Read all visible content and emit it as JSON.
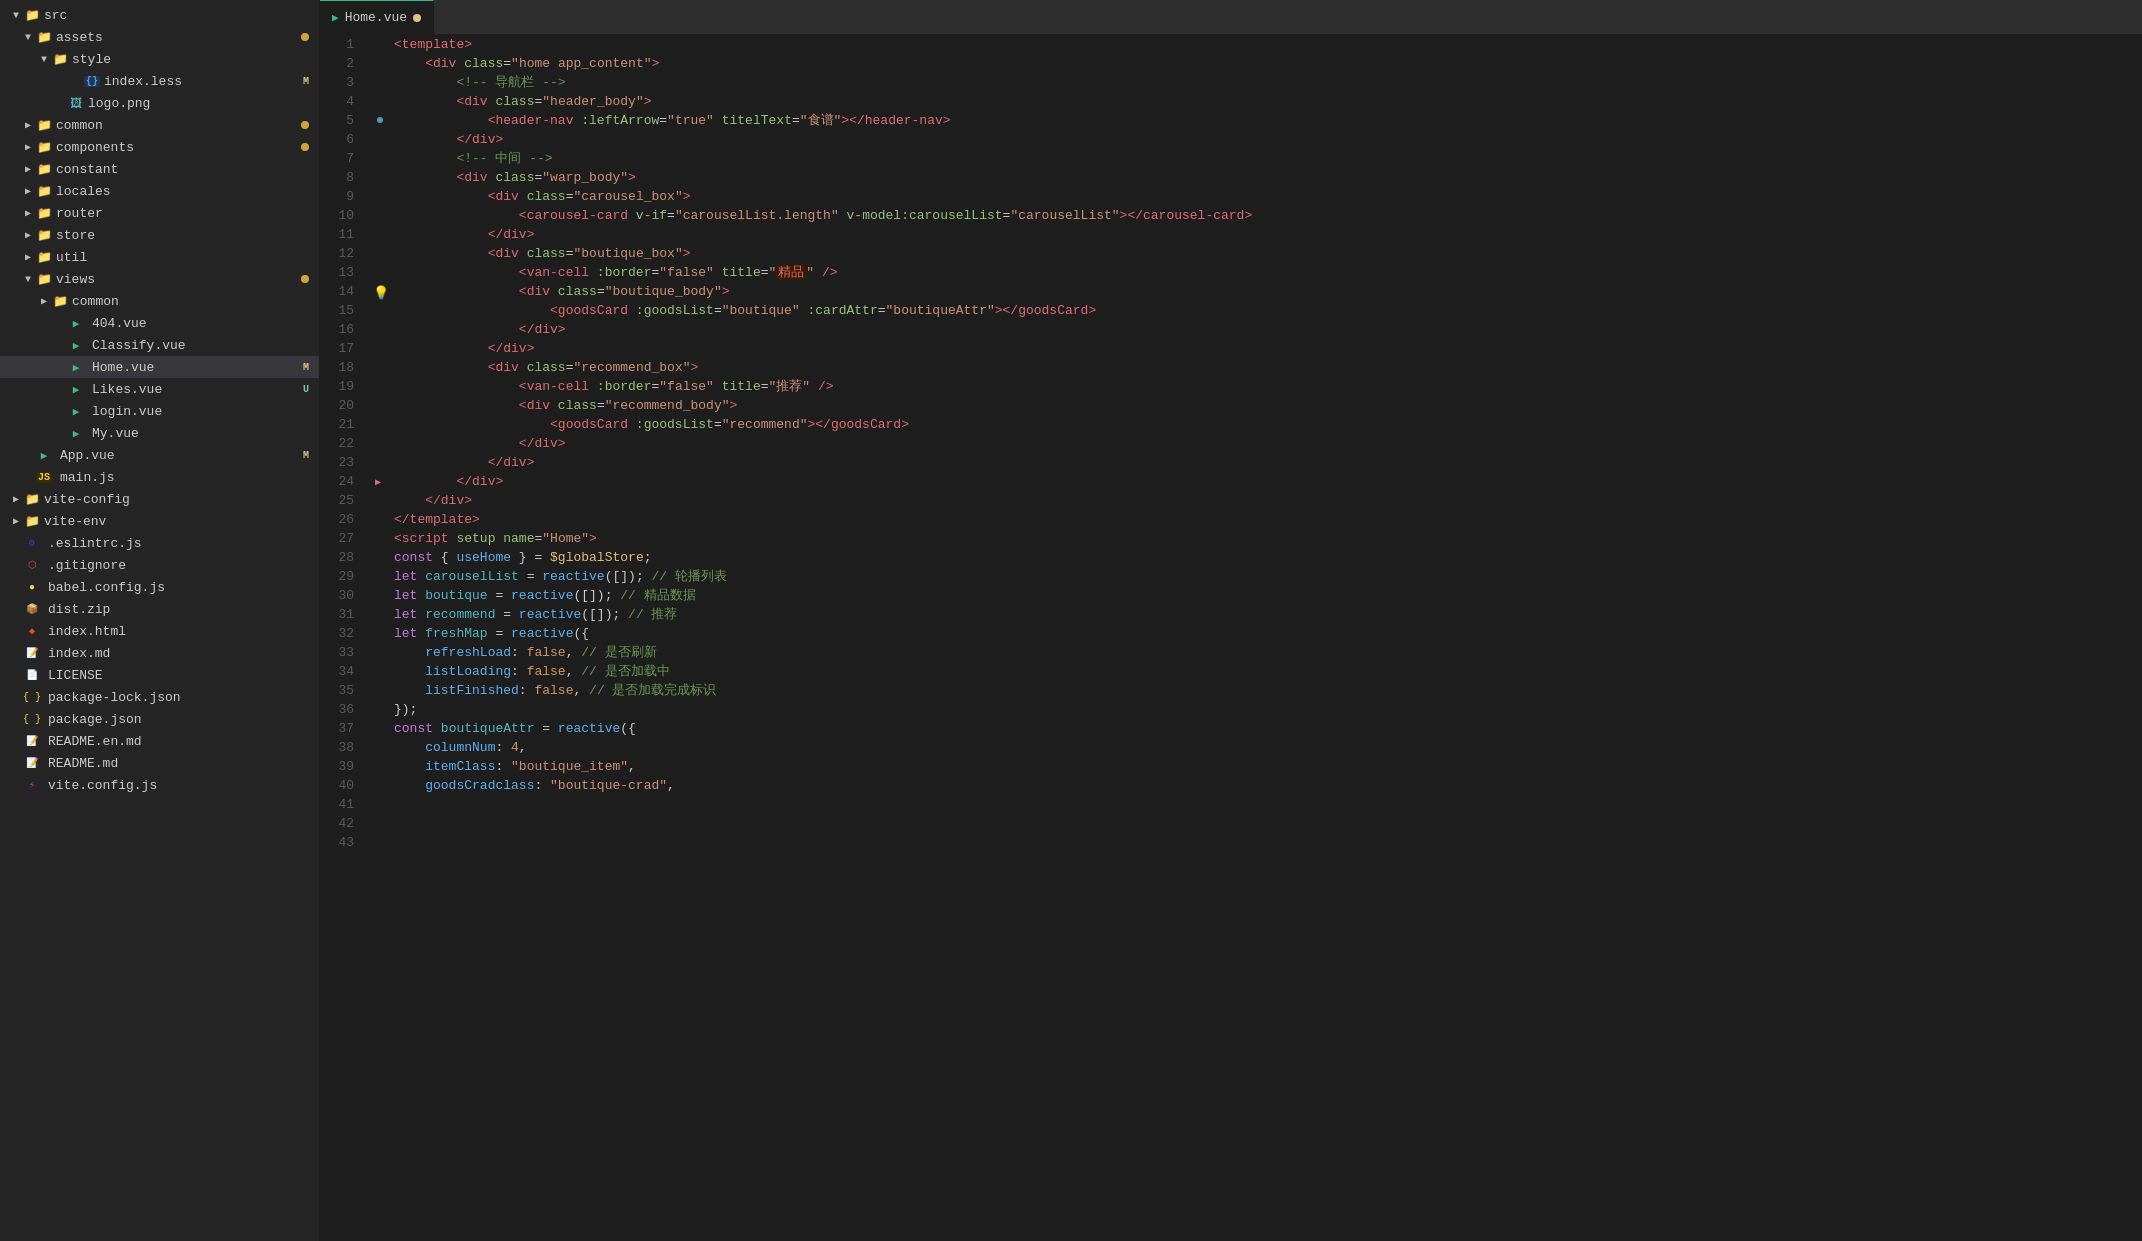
{
  "sidebar": {
    "items": [
      {
        "id": "src",
        "label": "src",
        "level": 0,
        "type": "folder",
        "expanded": true,
        "arrow": "▼"
      },
      {
        "id": "assets",
        "label": "assets",
        "level": 1,
        "type": "folder",
        "expanded": true,
        "arrow": "▼",
        "badge": "",
        "dot": true
      },
      {
        "id": "style",
        "label": "style",
        "level": 2,
        "type": "folder",
        "expanded": true,
        "arrow": "▼"
      },
      {
        "id": "index.less",
        "label": "index.less",
        "level": 3,
        "type": "less",
        "badge": "M"
      },
      {
        "id": "logo.png",
        "label": "logo.png",
        "level": 2,
        "type": "image"
      },
      {
        "id": "common",
        "label": "common",
        "level": 1,
        "type": "folder",
        "expanded": false,
        "arrow": "▶",
        "dot": true
      },
      {
        "id": "components",
        "label": "components",
        "level": 1,
        "type": "folder",
        "expanded": false,
        "arrow": "▶",
        "dot": true
      },
      {
        "id": "constant",
        "label": "constant",
        "level": 1,
        "type": "folder",
        "expanded": false,
        "arrow": "▶"
      },
      {
        "id": "locales",
        "label": "locales",
        "level": 1,
        "type": "folder",
        "expanded": false,
        "arrow": "▶"
      },
      {
        "id": "router",
        "label": "router",
        "level": 1,
        "type": "folder",
        "expanded": false,
        "arrow": "▶"
      },
      {
        "id": "store",
        "label": "store",
        "level": 1,
        "type": "folder",
        "expanded": false,
        "arrow": "▶"
      },
      {
        "id": "util",
        "label": "util",
        "level": 1,
        "type": "folder",
        "expanded": false,
        "arrow": "▶"
      },
      {
        "id": "views",
        "label": "views",
        "level": 1,
        "type": "folder",
        "expanded": true,
        "arrow": "▼",
        "dot": true
      },
      {
        "id": "common2",
        "label": "common",
        "level": 2,
        "type": "folder",
        "expanded": false,
        "arrow": "▶"
      },
      {
        "id": "404.vue",
        "label": "404.vue",
        "level": 2,
        "type": "vue"
      },
      {
        "id": "Classify.vue",
        "label": "Classify.vue",
        "level": 2,
        "type": "vue"
      },
      {
        "id": "Home.vue",
        "label": "Home.vue",
        "level": 2,
        "type": "vue",
        "selected": true,
        "badge": "M"
      },
      {
        "id": "Likes.vue",
        "label": "Likes.vue",
        "level": 2,
        "type": "vue",
        "badge": "U"
      },
      {
        "id": "login.vue",
        "label": "login.vue",
        "level": 2,
        "type": "vue"
      },
      {
        "id": "My.vue",
        "label": "My.vue",
        "level": 2,
        "type": "vue"
      },
      {
        "id": "App.vue",
        "label": "App.vue",
        "level": 1,
        "type": "vue",
        "badge": "M"
      },
      {
        "id": "main.js",
        "label": "main.js",
        "level": 1,
        "type": "js"
      },
      {
        "id": "vite-config",
        "label": "vite-config",
        "level": 0,
        "type": "folder",
        "expanded": false,
        "arrow": "▶"
      },
      {
        "id": "vite-env",
        "label": "vite-env",
        "level": 0,
        "type": "folder",
        "expanded": false,
        "arrow": "▶"
      },
      {
        "id": ".eslintrc.js",
        "label": ".eslintrc.js",
        "level": 0,
        "type": "js-config"
      },
      {
        "id": ".gitignore",
        "label": ".gitignore",
        "level": 0,
        "type": "git"
      },
      {
        "id": "babel.config.js",
        "label": "babel.config.js",
        "level": 0,
        "type": "babel"
      },
      {
        "id": "dist.zip",
        "label": "dist.zip",
        "level": 0,
        "type": "zip"
      },
      {
        "id": "index.html",
        "label": "index.html",
        "level": 0,
        "type": "html"
      },
      {
        "id": "index.md",
        "label": "index.md",
        "level": 0,
        "type": "md"
      },
      {
        "id": "LICENSE",
        "label": "LICENSE",
        "level": 0,
        "type": "license"
      },
      {
        "id": "package-lock.json",
        "label": "package-lock.json",
        "level": 0,
        "type": "json"
      },
      {
        "id": "package.json",
        "label": "package.json",
        "level": 0,
        "type": "json"
      },
      {
        "id": "README.en.md",
        "label": "README.en.md",
        "level": 0,
        "type": "md"
      },
      {
        "id": "README.md",
        "label": "README.md",
        "level": 0,
        "type": "md"
      },
      {
        "id": "vite.config.js",
        "label": "vite.config.js",
        "level": 0,
        "type": "js"
      }
    ]
  },
  "tabs": [
    {
      "label": "Home.vue",
      "active": true,
      "badge": "M",
      "icon": "vue"
    }
  ],
  "code_lines": [
    {
      "num": 1,
      "content": "<template>"
    },
    {
      "num": 2,
      "content": "    <div class=\"home app_content\">"
    },
    {
      "num": 3,
      "content": "        <!-- 导航栏 -->"
    },
    {
      "num": 4,
      "content": "        <div class=\"header_body\">"
    },
    {
      "num": 5,
      "content": "            <header-nav :leftArrow=\"true\" titelText=\"食谱\"></header-nav>",
      "gutter": "blue"
    },
    {
      "num": 6,
      "content": "        </div>"
    },
    {
      "num": 7,
      "content": ""
    },
    {
      "num": 8,
      "content": "        <!-- 中间 -->"
    },
    {
      "num": 9,
      "content": "        <div class=\"warp_body\">"
    },
    {
      "num": 10,
      "content": "            <div class=\"carousel_box\">"
    },
    {
      "num": 11,
      "content": "                <carousel-card v-if=\"carouselList.length\" v-model:carouselList=\"carouselList\"></carousel-card>"
    },
    {
      "num": 12,
      "content": "            </div>"
    },
    {
      "num": 13,
      "content": "            <div class=\"boutique_box\">"
    },
    {
      "num": 14,
      "content": "                <van-cell :border=\"false\" title=\"精品\" />",
      "bulb": true
    },
    {
      "num": 15,
      "content": "                <div class=\"boutique_body\">"
    },
    {
      "num": 16,
      "content": "                    <goodsCard :goodsList=\"boutique\" :cardAttr=\"boutiqueAttr\"></goodsCard>"
    },
    {
      "num": 17,
      "content": "                </div>"
    },
    {
      "num": 18,
      "content": "            </div>"
    },
    {
      "num": 19,
      "content": "            <div class=\"recommend_box\">"
    },
    {
      "num": 20,
      "content": "                <van-cell :border=\"false\" title=\"推荐\" />"
    },
    {
      "num": 21,
      "content": "                <div class=\"recommend_body\">"
    },
    {
      "num": 22,
      "content": "                    <goodsCard :goodsList=\"recommend\"></goodsCard>"
    },
    {
      "num": 23,
      "content": "                </div>"
    },
    {
      "num": 24,
      "content": "            </div>",
      "gutter": "red_arrow"
    },
    {
      "num": 25,
      "content": "        </div>"
    },
    {
      "num": 26,
      "content": "    </div>"
    },
    {
      "num": 27,
      "content": "</template>"
    },
    {
      "num": 28,
      "content": ""
    },
    {
      "num": 29,
      "content": "<script setup name=\"Home\">"
    },
    {
      "num": 30,
      "content": "const { useHome } = $globalStore;"
    },
    {
      "num": 31,
      "content": ""
    },
    {
      "num": 32,
      "content": "let carouselList = reactive([]); // 轮播列表"
    },
    {
      "num": 33,
      "content": "let boutique = reactive([]); // 精品数据"
    },
    {
      "num": 34,
      "content": "let recommend = reactive([]); // 推荐"
    },
    {
      "num": 35,
      "content": "let freshMap = reactive({"
    },
    {
      "num": 36,
      "content": "    refreshLoad: false, // 是否刷新"
    },
    {
      "num": 37,
      "content": "    listLoading: false, // 是否加载中"
    },
    {
      "num": 38,
      "content": "    listFinished: false, // 是否加载完成标识"
    },
    {
      "num": 39,
      "content": "});"
    },
    {
      "num": 40,
      "content": "const boutiqueAttr = reactive({"
    },
    {
      "num": 41,
      "content": "    columnNum: 4,"
    },
    {
      "num": 42,
      "content": "    itemClass: \"boutique_item\","
    },
    {
      "num": 43,
      "content": "    goodsCradclass: \"boutique-crad\","
    }
  ]
}
